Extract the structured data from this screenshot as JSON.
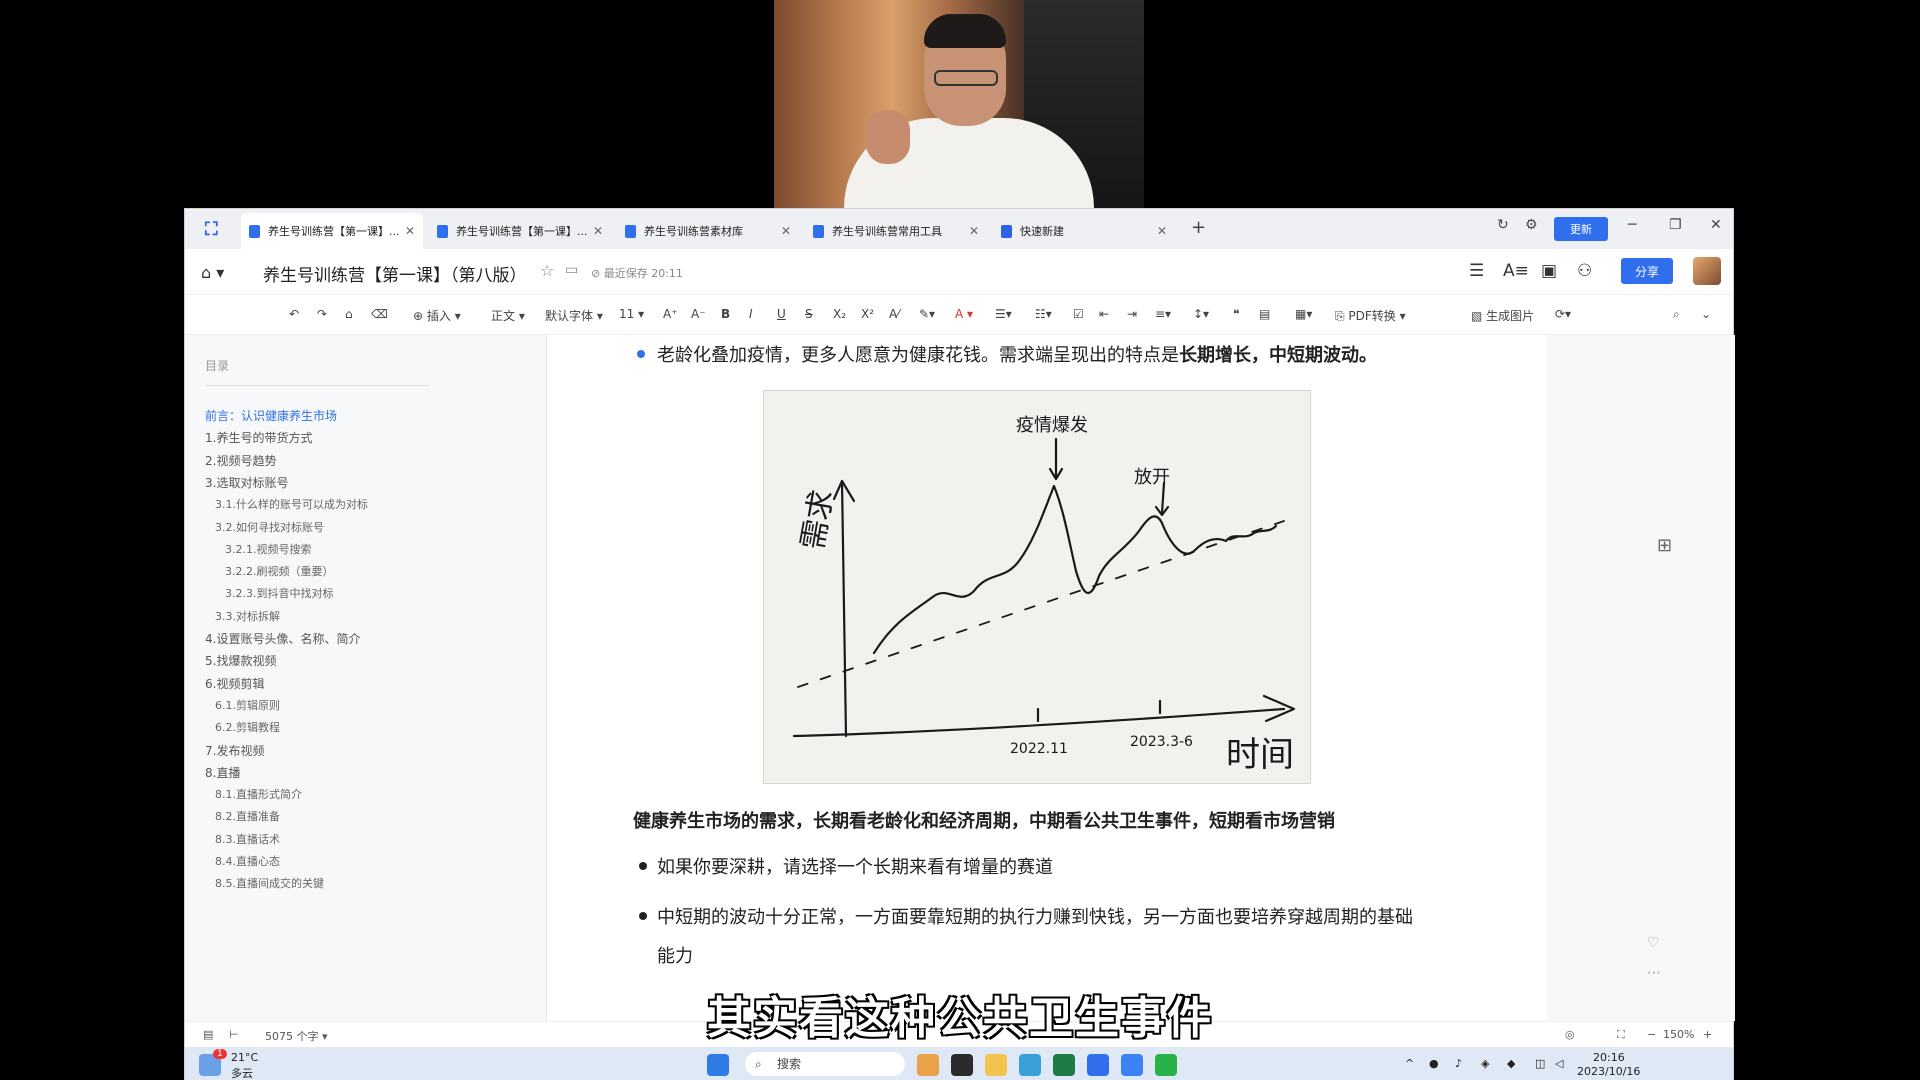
{
  "tabs": [
    {
      "label": "养生号训练营【第一课】...",
      "active": true
    },
    {
      "label": "养生号训练营【第一课】..."
    },
    {
      "label": "养生号训练营素材库"
    },
    {
      "label": "养生号训练营常用工具"
    },
    {
      "label": "快速新建"
    }
  ],
  "window": {
    "update_label": "更新"
  },
  "doc": {
    "title": "养生号训练营【第一课】（第八版）",
    "save_status": "最近保存 20:11",
    "share_label": "分享"
  },
  "toolbar": {
    "insert": "插入",
    "style": "正文",
    "font": "默认字体",
    "size": "11",
    "pdf": "PDF转换",
    "gen_image": "生成图片"
  },
  "toc": {
    "title": "目录",
    "items": [
      {
        "label": "前言：认识健康养生市场",
        "level": 1,
        "active": true
      },
      {
        "label": "1.养生号的带货方式",
        "level": 1
      },
      {
        "label": "2.视频号趋势",
        "level": 1
      },
      {
        "label": "3.选取对标账号",
        "level": 1
      },
      {
        "label": "3.1.什么样的账号可以成为对标",
        "level": 2
      },
      {
        "label": "3.2.如何寻找对标账号",
        "level": 2
      },
      {
        "label": "3.2.1.视频号搜索",
        "level": 3
      },
      {
        "label": "3.2.2.刷视频（重要）",
        "level": 3
      },
      {
        "label": "3.2.3.到抖音中找对标",
        "level": 3
      },
      {
        "label": "3.3.对标拆解",
        "level": 2
      },
      {
        "label": "4.设置账号头像、名称、简介",
        "level": 1
      },
      {
        "label": "5.找爆款视频",
        "level": 1
      },
      {
        "label": "6.视频剪辑",
        "level": 1
      },
      {
        "label": "6.1.剪辑原则",
        "level": 2
      },
      {
        "label": "6.2.剪辑教程",
        "level": 2
      },
      {
        "label": "7.发布视频",
        "level": 1
      },
      {
        "label": "8.直播",
        "level": 1
      },
      {
        "label": "8.1.直播形式简介",
        "level": 2
      },
      {
        "label": "8.2.直播准备",
        "level": 2
      },
      {
        "label": "8.3.直播话术",
        "level": 2
      },
      {
        "label": "8.4.直播心态",
        "level": 2
      },
      {
        "label": "8.5.直播间成交的关键",
        "level": 2
      }
    ]
  },
  "content": {
    "p1_normal": "老龄化叠加疫情，更多人愿意为健康花钱。需求端呈现出的特点是",
    "p1_bold": "长期增长，中短期波动。",
    "heading": "健康养生市场的需求，长期看老龄化和经济周期，中期看公共卫生事件，短期看市场营销",
    "b1": "如果你要深耕，请选择一个长期来看有增量的赛道",
    "b2_line1": "中短期的波动十分正常，一方面要靠短期的执行力赚到快钱，另一方面也要培养穿越周期的基础",
    "b2_line2": "能力"
  },
  "sketch": {
    "y_label": "需求",
    "x_label": "时间",
    "peak1_label": "疫情爆发",
    "peak2_label": "放开",
    "tick1": "2022.11",
    "tick2": "2023.3-6"
  },
  "status": {
    "word_count": "5075 个字",
    "zoom": "150%"
  },
  "taskbar": {
    "weather_temp": "21°C",
    "weather_desc": "多云",
    "search": "搜索",
    "time": "20:16",
    "date": "2023/10/16",
    "badge": "1"
  },
  "subtitle": "其实看这种公共卫生事件",
  "colors": {
    "accent": "#2f6fed"
  }
}
